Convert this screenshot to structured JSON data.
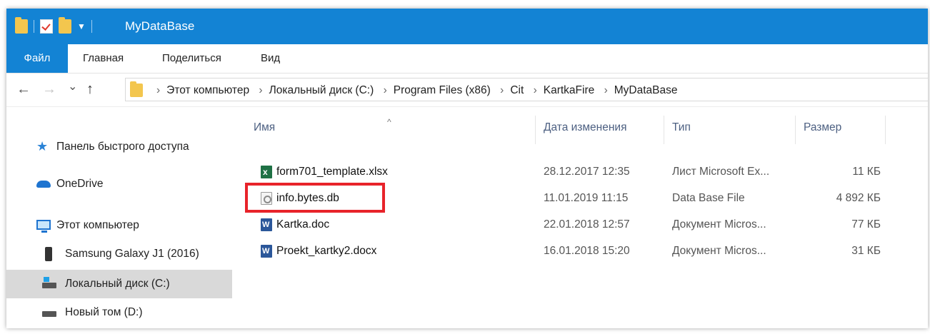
{
  "window": {
    "title": "MyDataBase"
  },
  "quick_access_toolbar": {
    "icons": [
      "folder-icon",
      "properties-check-icon",
      "new-folder-icon",
      "customize-dropdown-icon"
    ]
  },
  "ribbon": {
    "tabs": [
      "Файл",
      "Главная",
      "Поделиться",
      "Вид"
    ]
  },
  "navigation": {
    "back": "←",
    "forward": "→",
    "recent": "⌄",
    "up": "↑"
  },
  "breadcrumb": [
    "Этот компьютер",
    "Локальный диск (C:)",
    "Program Files (x86)",
    "Cit",
    "KartkaFire",
    "MyDataBase"
  ],
  "nav_pane": {
    "items": [
      {
        "label": "Панель быстрого доступа",
        "icon": "star-icon"
      },
      {
        "label": "OneDrive",
        "icon": "cloud-icon"
      },
      {
        "label": "Этот компьютер",
        "icon": "computer-icon"
      },
      {
        "label": "Samsung Galaxy J1 (2016)",
        "icon": "phone-icon"
      },
      {
        "label": "Локальный диск (C:)",
        "icon": "windows-drive-icon",
        "selected": true
      },
      {
        "label": "Новый том (D:)",
        "icon": "drive-icon"
      }
    ]
  },
  "columns": {
    "name": "Имя",
    "date": "Дата изменения",
    "type": "Тип",
    "size": "Размер"
  },
  "files": [
    {
      "name": "form701_template.xlsx",
      "date": "28.12.2017 12:35",
      "type": "Лист Microsoft Ex...",
      "size": "11 КБ",
      "icon": "excel-file-icon"
    },
    {
      "name": "info.bytes.db",
      "date": "11.01.2019 11:15",
      "type": "Data Base File",
      "size": "4 892 КБ",
      "icon": "database-file-icon",
      "highlighted": true
    },
    {
      "name": "Kartka.doc",
      "date": "22.01.2018 12:57",
      "type": "Документ Micros...",
      "size": "77 КБ",
      "icon": "word-file-icon"
    },
    {
      "name": "Proekt_kartky2.docx",
      "date": "16.01.2018 15:20",
      "type": "Документ Micros...",
      "size": "31 КБ",
      "icon": "word-file-icon"
    }
  ],
  "colors": {
    "accent": "#1383d4",
    "highlight_box": "#e8232a",
    "selected_nav": "#d9d9d9"
  }
}
